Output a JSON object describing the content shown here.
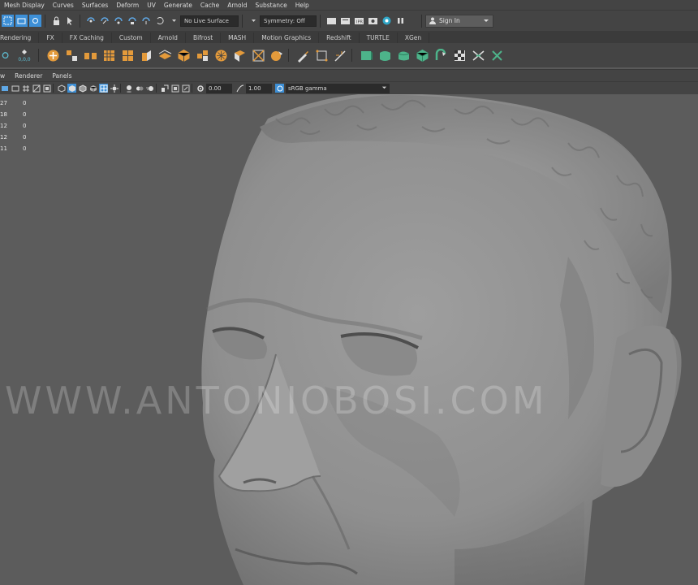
{
  "menubar": {
    "items": [
      "Mesh Display",
      "Curves",
      "Surfaces",
      "Deform",
      "UV",
      "Generate",
      "Cache",
      "Arnold",
      "Substance",
      "Help"
    ]
  },
  "statusline": {
    "live_surface": "No Live Surface",
    "symmetry": "Symmetry: Off",
    "sign_in": "Sign In"
  },
  "shelf_tabs": [
    "Rendering",
    "FX",
    "FX Caching",
    "Custom",
    "Arnold",
    "Bifrost",
    "MASH",
    "Motion Graphics",
    "Redshift",
    "TURTLE",
    "XGen"
  ],
  "shelf": {
    "left_readout": "0,0,0"
  },
  "panel_menu": {
    "items": [
      "w",
      "Renderer",
      "Panels"
    ]
  },
  "panel_toolbar": {
    "exposure": "0.00",
    "gamma": "1.00",
    "color_management": "sRGB gamma"
  },
  "hud": {
    "rows": [
      {
        "key": "27",
        "value": "0"
      },
      {
        "key": "18",
        "value": "0"
      },
      {
        "key": "12",
        "value": "0"
      },
      {
        "key": "12",
        "value": "0"
      },
      {
        "key": "11",
        "value": "0"
      }
    ]
  },
  "watermark": "WWW.ANTONIOBOSI.COM",
  "colors": {
    "ui_bg": "#444444",
    "viewport_bg": "#5c5c5c",
    "shelf_orange": "#e39a3b",
    "shelf_green": "#4db38a",
    "accent_blue": "#3d8fd6"
  }
}
